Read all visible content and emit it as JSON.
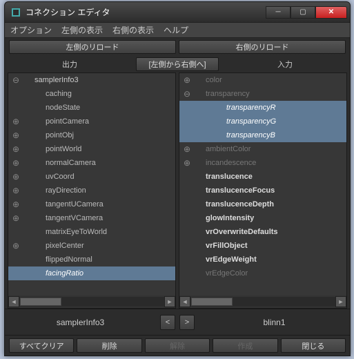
{
  "window": {
    "title": "コネクション エディタ"
  },
  "menu": {
    "options": "オプション",
    "leftDisplay": "左側の表示",
    "rightDisplay": "右側の表示",
    "help": "ヘルプ"
  },
  "toolbar": {
    "reloadLeft": "左側のリロード",
    "reloadRight": "右側のリロード"
  },
  "columns": {
    "output": "出力",
    "connect": "[左側から右側へ]",
    "input": "入力"
  },
  "left": {
    "root": "samplerInfo3",
    "items": [
      {
        "exp": "",
        "label": "caching",
        "cls": "attr"
      },
      {
        "exp": "",
        "label": "nodeState",
        "cls": "attr"
      },
      {
        "exp": "plus",
        "label": "pointCamera",
        "cls": "attr"
      },
      {
        "exp": "plus",
        "label": "pointObj",
        "cls": "attr"
      },
      {
        "exp": "plus",
        "label": "pointWorld",
        "cls": "attr"
      },
      {
        "exp": "plus",
        "label": "normalCamera",
        "cls": "attr"
      },
      {
        "exp": "plus",
        "label": "uvCoord",
        "cls": "attr"
      },
      {
        "exp": "plus",
        "label": "rayDirection",
        "cls": "attr"
      },
      {
        "exp": "plus",
        "label": "tangentUCamera",
        "cls": "attr"
      },
      {
        "exp": "plus",
        "label": "tangentVCamera",
        "cls": "attr"
      },
      {
        "exp": "",
        "label": "matrixEyeToWorld",
        "cls": "attr"
      },
      {
        "exp": "plus",
        "label": "pixelCenter",
        "cls": "attr"
      },
      {
        "exp": "",
        "label": "flippedNormal",
        "cls": "attr"
      },
      {
        "exp": "",
        "label": "facingRatio",
        "cls": "sel"
      }
    ]
  },
  "right": {
    "items": [
      {
        "exp": "plus",
        "label": "color",
        "cls": "dim",
        "indent": "root"
      },
      {
        "exp": "minus",
        "label": "transparency",
        "cls": "dim",
        "indent": "root"
      },
      {
        "exp": "",
        "label": "transparencyR",
        "cls": "selchild",
        "indent": "child"
      },
      {
        "exp": "",
        "label": "transparencyG",
        "cls": "selchild",
        "indent": "child"
      },
      {
        "exp": "",
        "label": "transparencyB",
        "cls": "selchild",
        "indent": "child"
      },
      {
        "exp": "plus",
        "label": "ambientColor",
        "cls": "dim",
        "indent": "root"
      },
      {
        "exp": "plus",
        "label": "incandescence",
        "cls": "dim",
        "indent": "root"
      },
      {
        "exp": "",
        "label": "translucence",
        "cls": "bold",
        "indent": "root"
      },
      {
        "exp": "",
        "label": "translucenceFocus",
        "cls": "bold",
        "indent": "root"
      },
      {
        "exp": "",
        "label": "translucenceDepth",
        "cls": "bold",
        "indent": "root"
      },
      {
        "exp": "",
        "label": "glowIntensity",
        "cls": "bold",
        "indent": "root"
      },
      {
        "exp": "",
        "label": "vrOverwriteDefaults",
        "cls": "bold",
        "indent": "root"
      },
      {
        "exp": "",
        "label": "vrFillObject",
        "cls": "bold",
        "indent": "root"
      },
      {
        "exp": "",
        "label": "vrEdgeWeight",
        "cls": "bold",
        "indent": "root"
      },
      {
        "exp": "",
        "label": "vrEdgeColor",
        "cls": "dim",
        "indent": "root"
      }
    ]
  },
  "nodes": {
    "left": "samplerInfo3",
    "right": "blinn1",
    "prev": "<",
    "next": ">"
  },
  "footer": {
    "clearAll": "すべてクリア",
    "delete": "削除",
    "break": "解除",
    "make": "作成",
    "close": "閉じる"
  }
}
